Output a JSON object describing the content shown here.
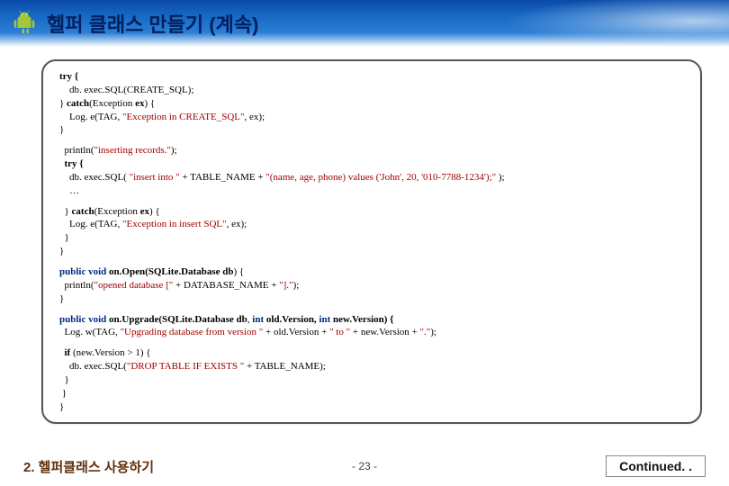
{
  "header": {
    "title": "헬퍼 클래스 만들기 (계속)"
  },
  "code": {
    "b1": {
      "l1": "try {",
      "l2": "    db. exec.SQL(CREATE_SQL);",
      "l3a": "} ",
      "l3b": "catch",
      "l3c": "(Exception ",
      "l3d": "ex",
      "l3e": ") {",
      "l4a": "    Log. e(TAG, ",
      "l4b": "\"Exception in CREATE_SQL\"",
      "l4c": ", ex);",
      "l5": "}"
    },
    "b2": {
      "l1a": "  println(",
      "l1b": "\"inserting records.\"",
      "l1c": ");",
      "l2": "  try {",
      "l3a": "    db. exec.SQL( ",
      "l3b": "\"insert into \"",
      "l3c": " + TABLE_NAME + ",
      "l3d": "\"(name, age, phone) values ('John', 20, '010-7788-1234');\"",
      "l3e": " );",
      "l4": "    …"
    },
    "b3": {
      "l1a": "  } ",
      "l1b": "catch",
      "l1c": "(Exception ",
      "l1d": "ex",
      "l1e": ") {",
      "l2a": "    Log. e(TAG, ",
      "l2b": "\"Exception in insert SQL\"",
      "l2c": ", ex);",
      "l3": "  }",
      "l4": "}"
    },
    "b4": {
      "l1a": "public void",
      "l1b": " on.Open",
      "l1c": "(SQLite.Database ",
      "l1d": "db",
      "l1e": ") {",
      "l2a": "  println(",
      "l2b": "\"opened database [\"",
      "l2c": " + DATABASE_NAME + ",
      "l2d": "\"].\"",
      "l2e": ");",
      "l3": "}"
    },
    "b5": {
      "l1a": "public void",
      "l1b": " on.Upgrade",
      "l1c": "(SQLite.Database ",
      "l1d": "db",
      "l1e": ", ",
      "l1f": "int",
      "l1g": " old.Version, ",
      "l1h": "int",
      "l1i": " new.Version) {",
      "l2a": "  Log. w(TAG, ",
      "l2b": "\"Upgrading database from version \"",
      "l2c": " + old.Version + ",
      "l2d": "\" to \"",
      "l2e": " + new.Version + ",
      "l2f": "\".\"",
      "l2g": ");"
    },
    "b6": {
      "l1a": "  if",
      "l1b": " (new.Version > 1) {",
      "l2a": "    db. exec.SQL(",
      "l2b": "\"DROP TABLE IF EXISTS \"",
      "l2c": " + TABLE_NAME);",
      "l3": "  }",
      "l4": " }",
      "l5": "}"
    }
  },
  "footer": {
    "section": "2. 헬퍼클래스 사용하기",
    "page": "- 23 -",
    "continued": "Continued. ."
  }
}
